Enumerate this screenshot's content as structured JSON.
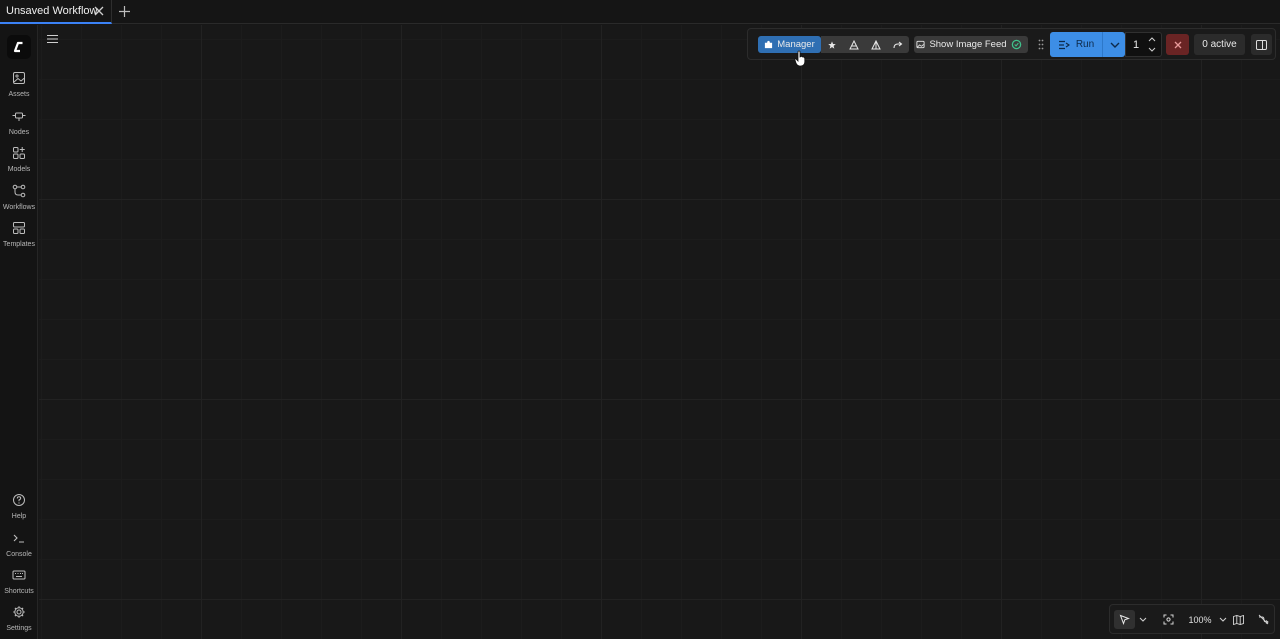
{
  "tabs": [
    {
      "title": "Unsaved Workflow",
      "active": true
    }
  ],
  "sidebar": {
    "top_items": [
      {
        "label": "Assets",
        "icon": "image-icon"
      },
      {
        "label": "Nodes",
        "icon": "node-icon"
      },
      {
        "label": "Models",
        "icon": "models-icon"
      },
      {
        "label": "Workflows",
        "icon": "workflow-icon"
      },
      {
        "label": "Templates",
        "icon": "templates-icon"
      }
    ],
    "bottom_items": [
      {
        "label": "Help",
        "icon": "help-icon"
      },
      {
        "label": "Console",
        "icon": "terminal-icon"
      },
      {
        "label": "Shortcuts",
        "icon": "keyboard-icon"
      },
      {
        "label": "Settings",
        "icon": "gear-icon"
      }
    ]
  },
  "toolbar": {
    "manager_label": "Manager",
    "feed_label": "Show Image Feed",
    "run_label": "Run",
    "run_count": "1",
    "active_label": "0 active"
  },
  "viewbar": {
    "zoom_label": "100%"
  },
  "colors": {
    "accent_blue": "#3d8ee6",
    "manager_blue": "#2f6fb3",
    "stop_red": "#6a2424",
    "canvas_bg": "#181818"
  }
}
